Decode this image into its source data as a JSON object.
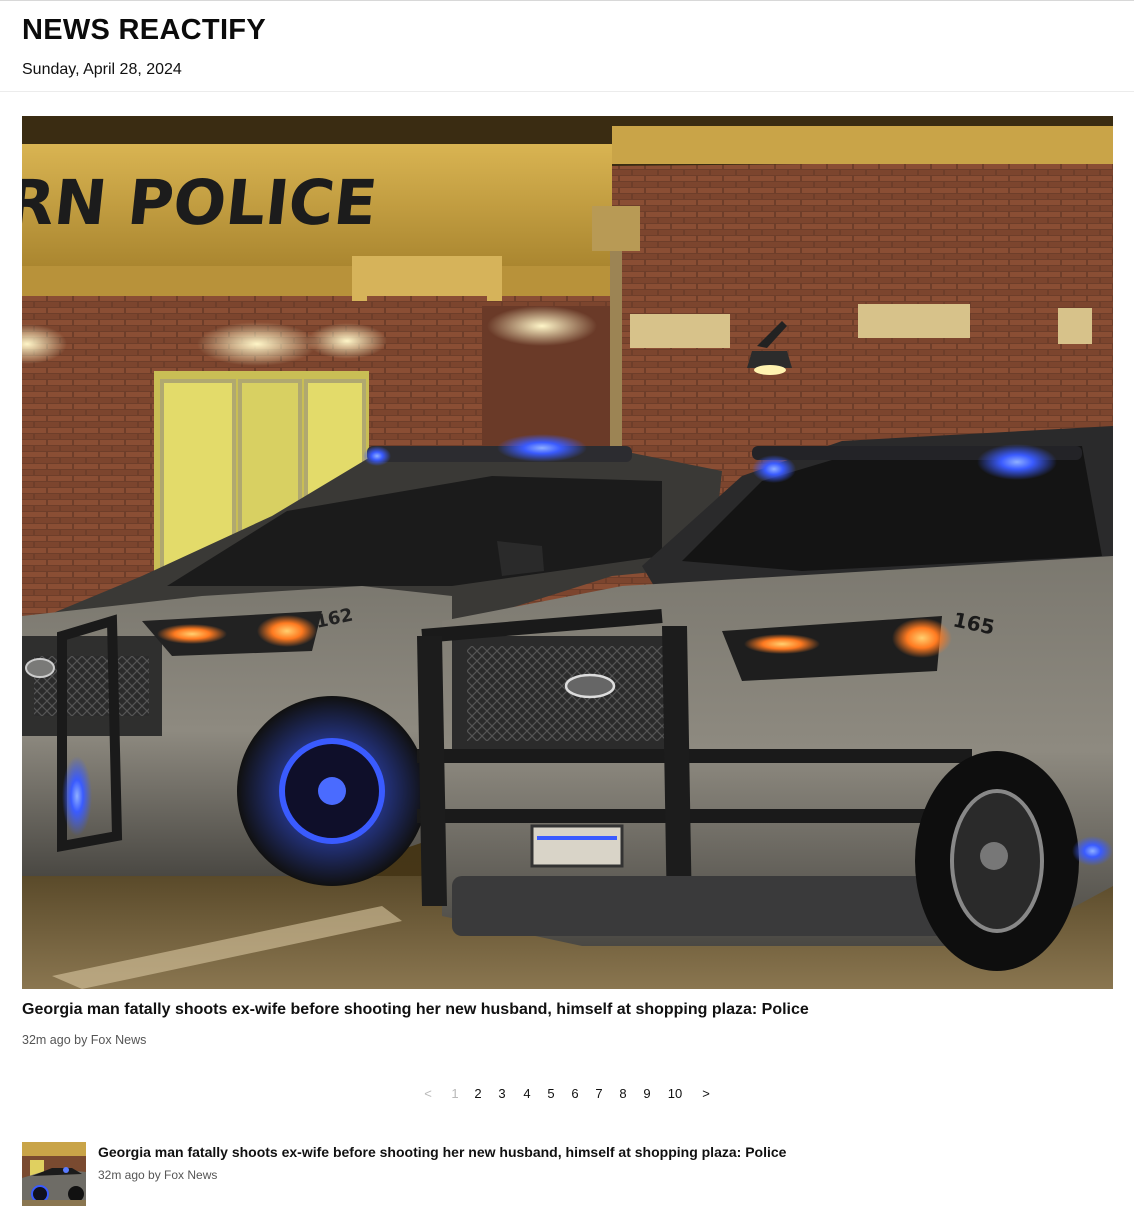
{
  "header": {
    "site_title": "NEWS REACTIFY",
    "date": "Sunday, April 28, 2024"
  },
  "featured": {
    "sign_text": "RN POLICE",
    "unit_left": "162",
    "unit_right": "165",
    "headline": "Georgia man fatally shoots ex-wife before shooting her new husband, himself at shopping plaza: Police",
    "meta": "32m ago by Fox News"
  },
  "pagination": {
    "prev": "<",
    "next": ">",
    "current": "1",
    "pages": [
      "1",
      "2",
      "3",
      "4",
      "5",
      "6",
      "7",
      "8",
      "9",
      "10"
    ]
  },
  "articles": [
    {
      "title": "Georgia man fatally shoots ex-wife before shooting her new husband, himself at shopping plaza: Police",
      "meta": "32m ago by Fox News"
    }
  ],
  "colors": {
    "text": "#111111",
    "muted": "#555555",
    "disabled": "#b9b9b9",
    "siren_blue": "#3a5bff"
  }
}
